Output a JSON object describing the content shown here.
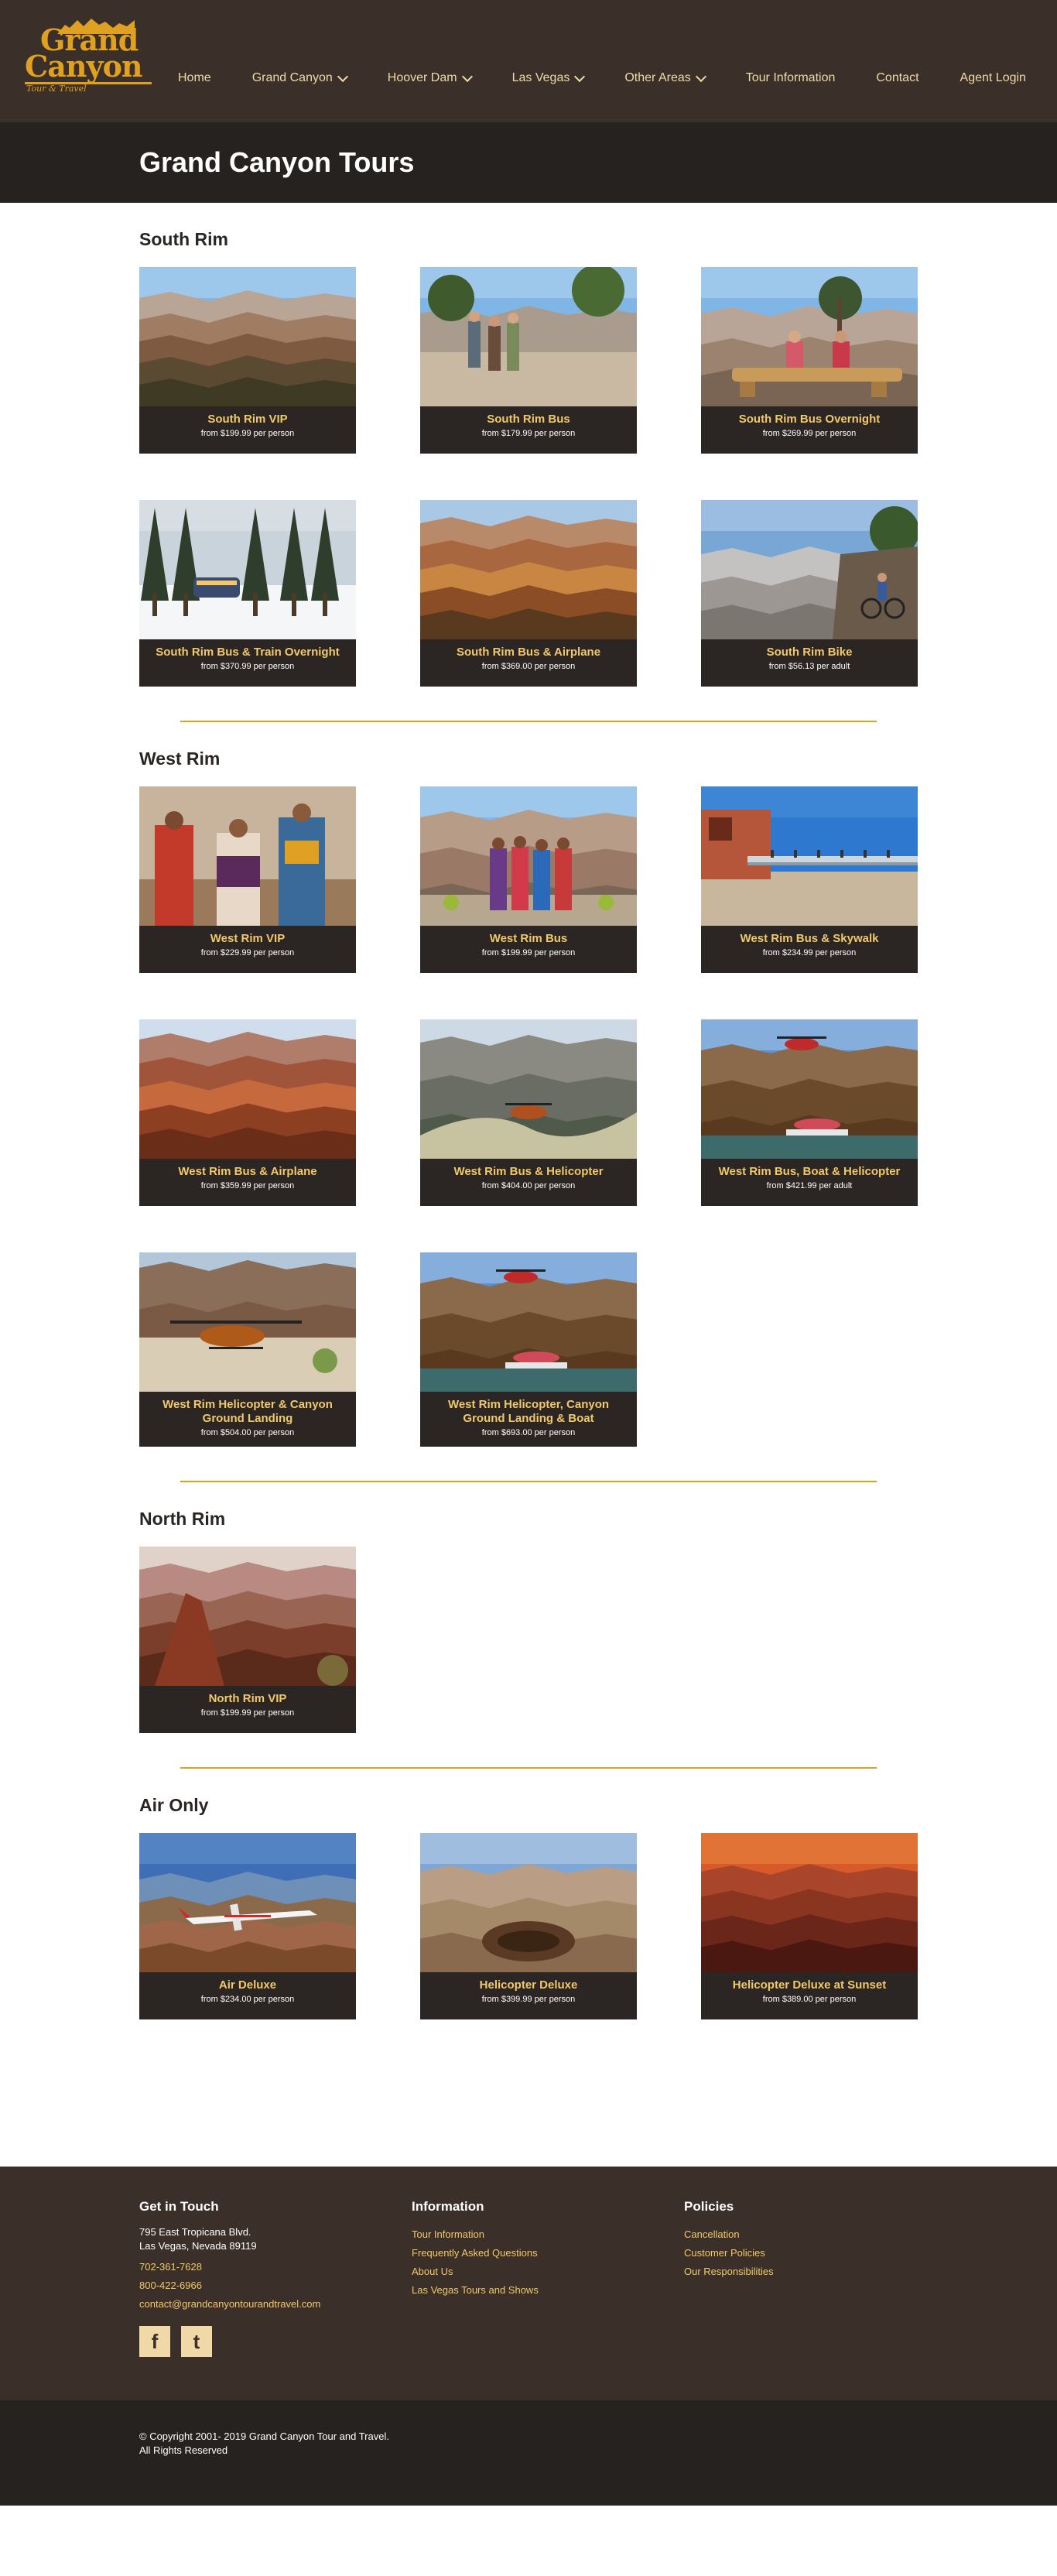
{
  "logo": {
    "line1": "Grand",
    "line2": "Canyon",
    "tagline": "Tour & Travel"
  },
  "nav": [
    {
      "label": "Home",
      "dropdown": false
    },
    {
      "label": "Grand Canyon",
      "dropdown": true
    },
    {
      "label": "Hoover Dam",
      "dropdown": true
    },
    {
      "label": "Las Vegas",
      "dropdown": true
    },
    {
      "label": "Other Areas",
      "dropdown": true
    },
    {
      "label": "Tour Information",
      "dropdown": false
    },
    {
      "label": "Contact",
      "dropdown": false
    },
    {
      "label": "Agent Login",
      "dropdown": false
    }
  ],
  "page_title": "Grand Canyon Tours",
  "sections": [
    {
      "title": "South Rim",
      "cards": [
        {
          "name": "South Rim VIP",
          "price": "from $199.99 per person",
          "scene": "canyon"
        },
        {
          "name": "South Rim Bus",
          "price": "from $179.99 per person",
          "scene": "people-trees"
        },
        {
          "name": "South Rim Bus Overnight",
          "price": "from $269.99 per person",
          "scene": "bench"
        },
        {
          "name": "South Rim Bus & Train Overnight",
          "price": "from $370.99 per person",
          "scene": "snow-train"
        },
        {
          "name": "South Rim Bus & Airplane",
          "price": "from $369.00 per person",
          "scene": "canyon-warm"
        },
        {
          "name": "South Rim Bike",
          "price": "from $56.13 per adult",
          "scene": "bike"
        }
      ]
    },
    {
      "title": "West Rim",
      "cards": [
        {
          "name": "West Rim VIP",
          "price": "from $229.99 per person",
          "scene": "natives"
        },
        {
          "name": "West Rim Bus",
          "price": "from $199.99 per person",
          "scene": "natives-canyon"
        },
        {
          "name": "West Rim Bus & Skywalk",
          "price": "from $234.99 per person",
          "scene": "skywalk"
        },
        {
          "name": "West Rim Bus & Airplane",
          "price": "from $359.99 per person",
          "scene": "canyon-red"
        },
        {
          "name": "West Rim Bus & Helicopter",
          "price": "from $404.00 per person",
          "scene": "heli-river"
        },
        {
          "name": "West Rim Bus, Boat & Helicopter",
          "price": "from $421.99 per adult",
          "scene": "heli-boat"
        },
        {
          "name": "West Rim Helicopter & Canyon Ground Landing",
          "price": "from $504.00 per person",
          "scene": "heli-ground"
        },
        {
          "name": "West Rim Helicopter, Canyon Ground Landing & Boat",
          "price": "from $693.00 per person",
          "scene": "heli-boat"
        }
      ]
    },
    {
      "title": "North Rim",
      "cards": [
        {
          "name": "North Rim VIP",
          "price": "from $199.99 per person",
          "scene": "north-rim"
        }
      ]
    },
    {
      "title": "Air Only",
      "cards": [
        {
          "name": "Air Deluxe",
          "price": "from $234.00 per person",
          "scene": "airplane"
        },
        {
          "name": "Helicopter Deluxe",
          "price": "from $399.99 per person",
          "scene": "aerial"
        },
        {
          "name": "Helicopter Deluxe at Sunset",
          "price": "from $389.00 per person",
          "scene": "sunset"
        }
      ]
    }
  ],
  "footer": {
    "contact": {
      "title": "Get in Touch",
      "address1": "795 East Tropicana Blvd.",
      "address2": "Las Vegas, Nevada 89119",
      "phone1": "702-361-7628",
      "phone2": "800-422-6966",
      "email": "contact@grandcanyontourandtravel.com"
    },
    "information": {
      "title": "Information",
      "links": [
        "Tour Information",
        "Frequently Asked Questions",
        "About Us",
        "Las Vegas Tours and Shows"
      ]
    },
    "policies": {
      "title": "Policies",
      "links": [
        "Cancellation",
        "Customer Policies",
        "Our Responsibilities"
      ]
    },
    "social": [
      {
        "icon": "facebook-icon",
        "glyph": "f"
      },
      {
        "icon": "twitter-icon",
        "glyph": "t"
      }
    ]
  },
  "copyright": {
    "line1": "© Copyright 2001- 2019 Grand Canyon Tour and Travel.",
    "line2": "All Rights Reserved"
  }
}
